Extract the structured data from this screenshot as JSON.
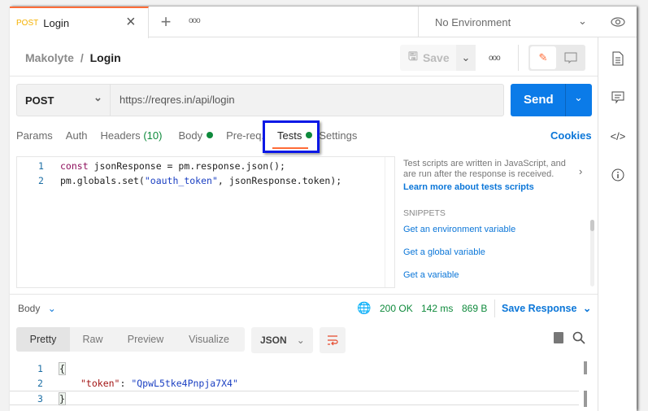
{
  "tab": {
    "method": "POST",
    "name": "Login"
  },
  "environment": "No Environment",
  "breadcrumb": {
    "collection": "Makolyte",
    "separator": "/",
    "request": "Login"
  },
  "toolbar": {
    "save_label": "Save"
  },
  "request": {
    "method": "POST",
    "url": "https://reqres.in/api/login",
    "send_label": "Send"
  },
  "req_tabs": {
    "params": "Params",
    "auth": "Auth",
    "headers": "Headers",
    "headers_count": "(10)",
    "body": "Body",
    "prereq": "Pre-req.",
    "tests": "Tests",
    "settings": "Settings",
    "cookies": "Cookies"
  },
  "editor": {
    "lines": [
      {
        "n": "1",
        "parts": [
          {
            "t": "const ",
            "c": "#8e0f5c"
          },
          {
            "t": "jsonResponse = pm.response.json();",
            "c": "#212121"
          }
        ]
      },
      {
        "n": "2",
        "parts": [
          {
            "t": "pm.globals.set(",
            "c": "#212121"
          },
          {
            "t": "\"oauth_token\"",
            "c": "#1a3fc2"
          },
          {
            "t": ", jsonResponse.token);",
            "c": "#212121"
          }
        ]
      }
    ]
  },
  "help": {
    "text": "Test scripts are written in JavaScript, and are run after the response is received.",
    "link": "Learn more about tests scripts",
    "snippets_title": "SNIPPETS",
    "snippets": [
      "Get an environment variable",
      "Get a global variable",
      "Get a variable"
    ]
  },
  "response": {
    "label": "Body",
    "status": "200 OK",
    "time": "142 ms",
    "size": "869 B",
    "save_label": "Save Response",
    "view_tabs": [
      "Pretty",
      "Raw",
      "Preview",
      "Visualize"
    ],
    "format": "JSON",
    "lines": [
      {
        "n": "1",
        "text": "{"
      },
      {
        "n": "2",
        "key": "\"token\"",
        "sep": ": ",
        "val": "\"QpwL5tke4Pnpja7X4\""
      },
      {
        "n": "3",
        "text": "}"
      }
    ]
  },
  "colors": {
    "accent": "#ff6c37",
    "send": "#0b7be8",
    "link": "#0b76d8",
    "success": "#0f8a3c",
    "highlight": "#0a18e6"
  }
}
